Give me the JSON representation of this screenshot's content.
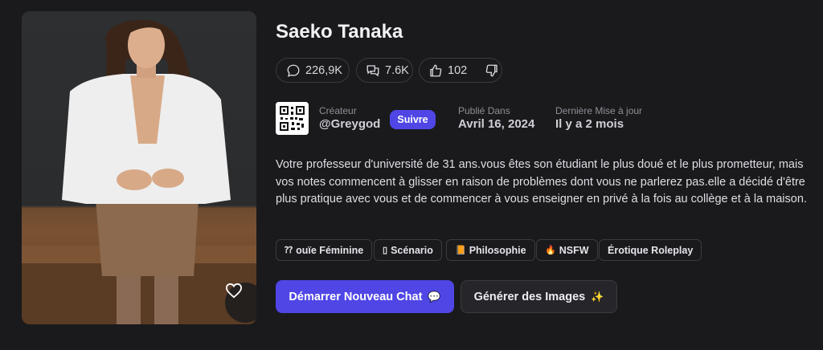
{
  "character": {
    "name": "Saeko Tanaka",
    "image_alt": "character portrait",
    "favorite_icon": "heart-icon"
  },
  "stats": {
    "comments": "226,9K",
    "comments_icon": "comment-icon",
    "chats": "7.6K",
    "chats_icon": "chats-icon",
    "likes": "102",
    "likes_icon": "thumbs-up-icon",
    "dislike_icon": "thumbs-down-icon"
  },
  "creator": {
    "label": "Créateur",
    "handle": "@Greygod",
    "follow_label": "Suivre"
  },
  "published": {
    "label": "Publié Dans",
    "value": "Avril 16, 2024"
  },
  "updated": {
    "label": "Dernière Mise à jour",
    "value": "Il y a 2 mois"
  },
  "description": "Votre professeur d'université de 31 ans.vous êtes son étudiant le plus doué et le plus prometteur, mais vos notes commencent à glisser en raison de problèmes dont vous ne parlerez pas.elle a décidé d'être plus pratique avec vous et de commencer à vous enseigner en privé à la fois au collège et à la maison.",
  "tags": [
    {
      "icon": "⁇",
      "label": "ouïe Féminine"
    },
    {
      "icon": "▯",
      "label": "Scénario"
    },
    {
      "icon": "📙",
      "label": "Philosophie"
    },
    {
      "icon": "🔥",
      "label": "NSFW"
    },
    {
      "icon": "",
      "label": "Érotique Roleplay"
    }
  ],
  "actions": {
    "start_chat": "Démarrer Nouveau Chat",
    "start_chat_emoji": "💬",
    "generate_images": "Générer des Images",
    "generate_images_emoji": "✨"
  },
  "colors": {
    "background": "#1a1a1d",
    "accent": "#4f46e5",
    "border": "#3a3a40",
    "text_muted": "#8f8f97"
  }
}
